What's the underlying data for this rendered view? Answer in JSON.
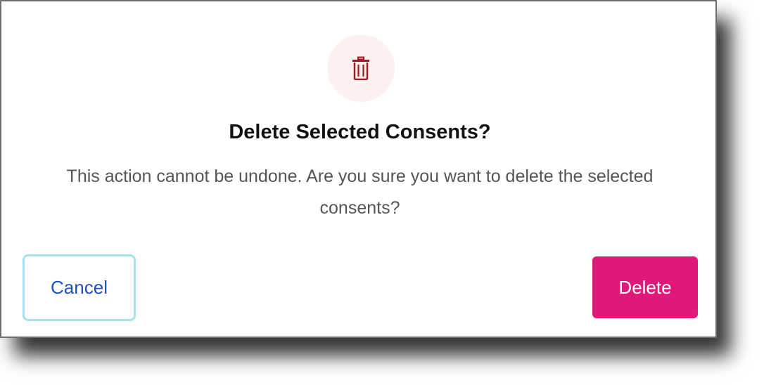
{
  "dialog": {
    "title": "Delete Selected Consents?",
    "message": "This action cannot be undone. Are you sure you want to delete the selected consents?",
    "icon": "trash-icon",
    "buttons": {
      "cancel_label": "Cancel",
      "delete_label": "Delete"
    }
  },
  "colors": {
    "delete_button": "#e01879",
    "cancel_border": "#a7e2ec",
    "cancel_text": "#1e52c4",
    "icon": "#a3191f",
    "icon_background": "#fdf1ef"
  }
}
